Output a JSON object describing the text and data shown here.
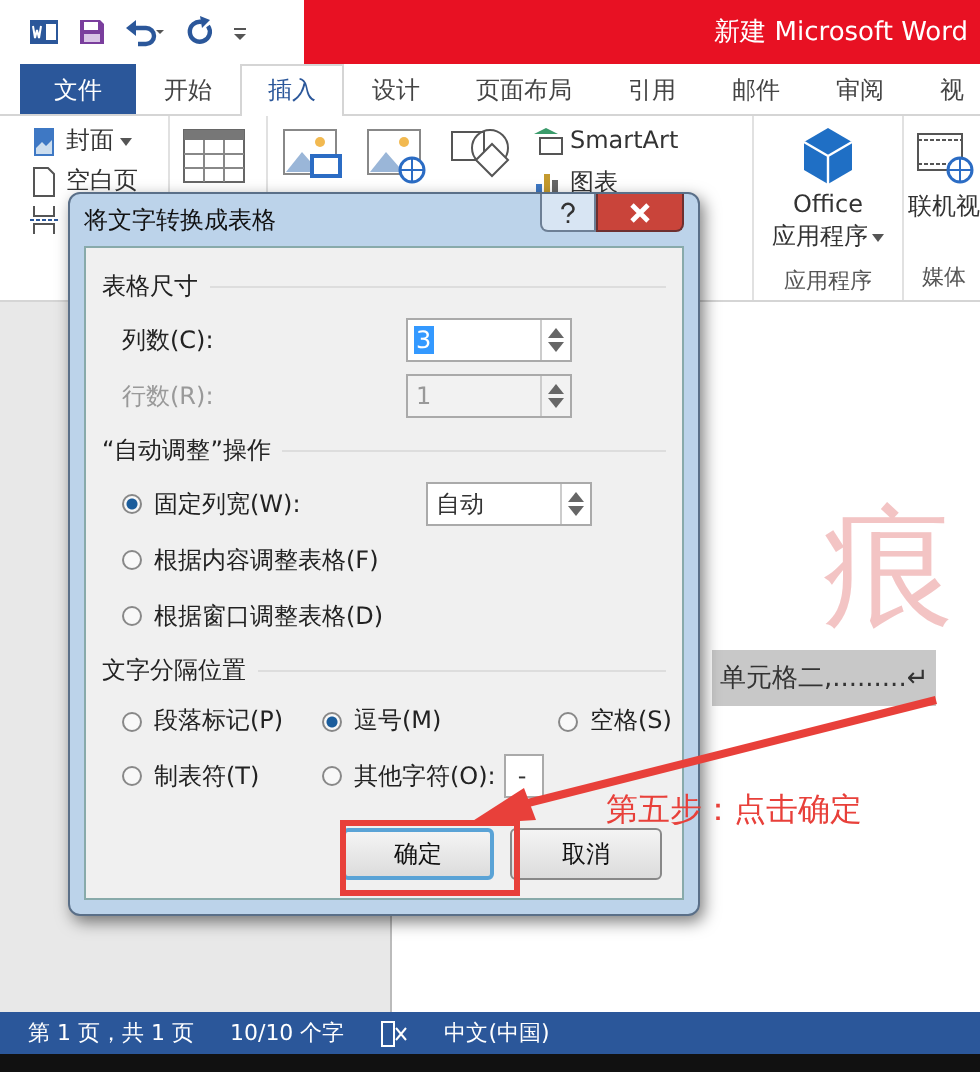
{
  "title_bar": {
    "title": "新建 Microsoft Word"
  },
  "tabs": [
    {
      "label": "文件",
      "kind": "file",
      "selected": false
    },
    {
      "label": "开始",
      "kind": "tab",
      "selected": false
    },
    {
      "label": "插入",
      "kind": "tab",
      "selected": true
    },
    {
      "label": "设计",
      "kind": "tab",
      "selected": false
    },
    {
      "label": "页面布局",
      "kind": "tab",
      "selected": false
    },
    {
      "label": "引用",
      "kind": "tab",
      "selected": false
    },
    {
      "label": "邮件",
      "kind": "tab",
      "selected": false
    },
    {
      "label": "审阅",
      "kind": "tab",
      "selected": false
    },
    {
      "label": "视",
      "kind": "tab",
      "selected": false
    }
  ],
  "ribbon": {
    "cover": "封面",
    "blank_page": "空白页",
    "smartart": "SmartArt",
    "chart": "图表",
    "office_app": {
      "line_1": "Office",
      "line_2": "应用程序"
    },
    "online_video": "联机视",
    "groups": [
      "应用程序",
      "媒体"
    ]
  },
  "document": {
    "text": "单元格二,.........↵",
    "selected": true,
    "watermark": "痕"
  },
  "dialog": {
    "title": "将文字转换成表格",
    "size_section": "表格尺寸",
    "fields": [
      {
        "label": "列数(C):",
        "value": "3",
        "disabled": false,
        "selected": true
      },
      {
        "label": "行数(R):",
        "value": "1",
        "disabled": true,
        "selected": false
      }
    ],
    "autofit_section": "“自动调整”操作",
    "autofit_options": [
      {
        "label": "固定列宽(W):",
        "selected": true,
        "value": "自动"
      },
      {
        "label": "根据内容调整表格(F)",
        "selected": false
      },
      {
        "label": "根据窗口调整表格(D)",
        "selected": false
      }
    ],
    "separator_section": "文字分隔位置",
    "separator_options": [
      {
        "label": "段落标记(P)",
        "selected": false
      },
      {
        "label": "逗号(M)",
        "selected": true
      },
      {
        "label": "空格(S)",
        "selected": false
      },
      {
        "label": "制表符(T)",
        "selected": false
      },
      {
        "label": "其他字符(O):",
        "selected": false,
        "value": "-"
      }
    ],
    "buttons": [
      {
        "label": "确定",
        "default": true
      },
      {
        "label": "取消",
        "default": false
      }
    ]
  },
  "annotation": {
    "text": "第五步：点击确定"
  },
  "status_bar": [
    "第 1 页，共 1 页",
    "10/10 个字",
    "中文(中国)"
  ]
}
